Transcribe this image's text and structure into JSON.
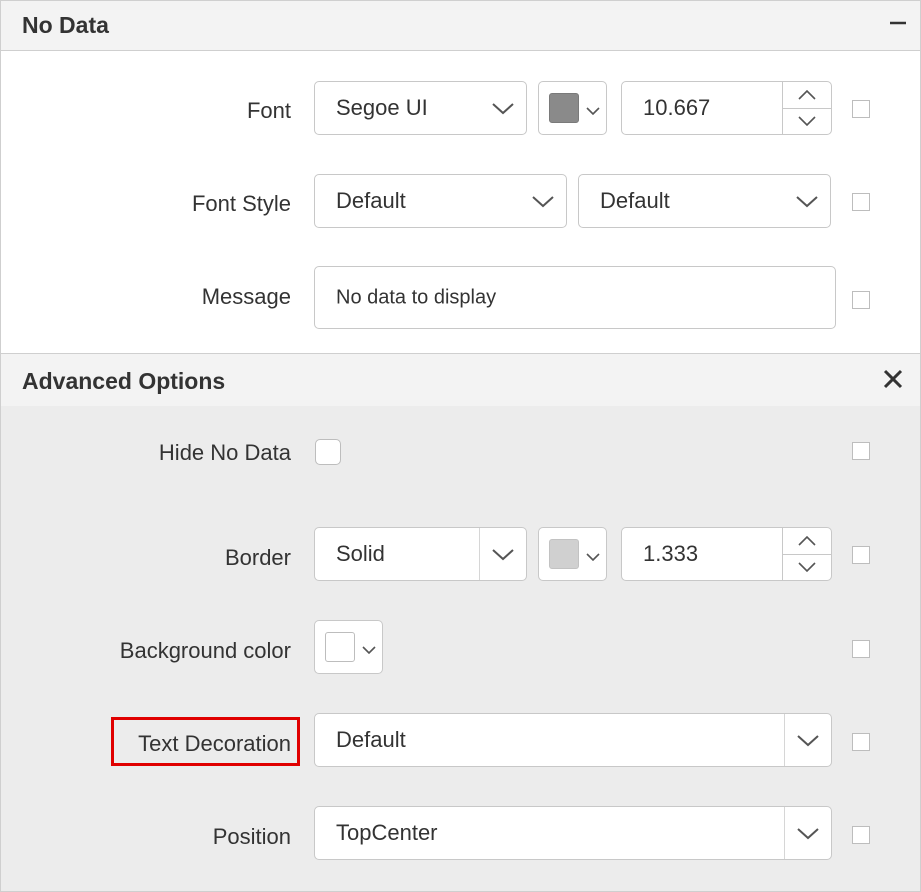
{
  "no_data_section": {
    "title": "No Data",
    "collapse_icon": "minus-icon",
    "font": {
      "label": "Font",
      "family": "Segoe UI",
      "color": "#8a8a8a",
      "size": "10.667"
    },
    "font_style": {
      "label": "Font Style",
      "style": "Default",
      "weight": "Default"
    },
    "message": {
      "label": "Message",
      "value": "No data to display"
    }
  },
  "advanced_section": {
    "title": "Advanced Options",
    "close_icon": "close-icon",
    "hide_no_data": {
      "label": "Hide No Data",
      "checked": false
    },
    "border": {
      "label": "Border",
      "style": "Solid",
      "color": "#d0d0d0",
      "width": "1.333"
    },
    "background_color": {
      "label": "Background color",
      "color": "#ffffff"
    },
    "text_decoration": {
      "label": "Text Decoration",
      "value": "Default",
      "highlight_color": "#e00000"
    },
    "position": {
      "label": "Position",
      "value": "TopCenter"
    }
  }
}
